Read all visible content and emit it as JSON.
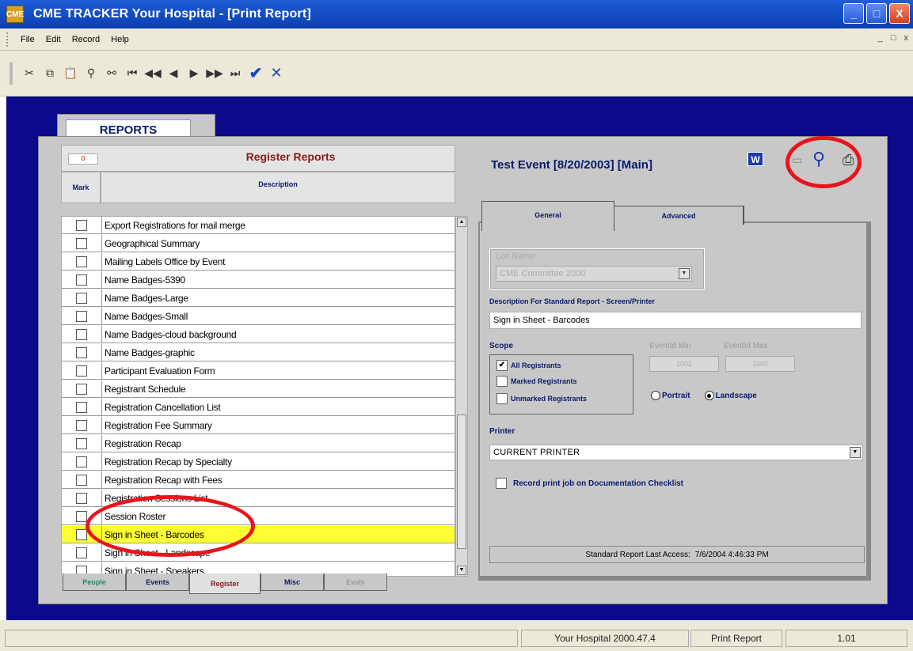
{
  "window": {
    "title": "CME TRACKER   Your Hospital - [Print Report]",
    "icon_label": "CME",
    "buttons": [
      "_",
      "□",
      "X"
    ]
  },
  "menu": {
    "items": [
      "File",
      "Edit",
      "Record",
      "Help"
    ],
    "mdi_controls": [
      "_",
      "□",
      "x"
    ]
  },
  "toolbar": {
    "icons": [
      "cut-icon",
      "copy-icon",
      "paste-icon",
      "find-icon",
      "find-replace-icon",
      "first-record-icon",
      "rewind-icon",
      "prev-record-icon",
      "next-record-icon",
      "fast-forward-icon",
      "last-record-icon",
      "save-check-icon",
      "cancel-icon"
    ]
  },
  "reports_tab": "REPORTS",
  "left": {
    "count": "0",
    "title": "Register Reports",
    "col_mark": "Mark",
    "col_desc": "Description",
    "rows": [
      {
        "label": "Export Registrations for mail merge",
        "selected": false
      },
      {
        "label": "Geographical Summary",
        "selected": false
      },
      {
        "label": "Mailing Labels Office by Event",
        "selected": false
      },
      {
        "label": "Name Badges-5390",
        "selected": false
      },
      {
        "label": "Name Badges-Large",
        "selected": false
      },
      {
        "label": "Name Badges-Small",
        "selected": false
      },
      {
        "label": "Name Badges-cloud background",
        "selected": false
      },
      {
        "label": "Name Badges-graphic",
        "selected": false
      },
      {
        "label": "Participant Evaluation Form",
        "selected": false
      },
      {
        "label": "Registrant Schedule",
        "selected": false
      },
      {
        "label": "Registration Cancellation List",
        "selected": false
      },
      {
        "label": "Registration Fee Summary",
        "selected": false
      },
      {
        "label": "Registration Recap",
        "selected": false
      },
      {
        "label": "Registration Recap by Specialty",
        "selected": false
      },
      {
        "label": "Registration Recap with Fees",
        "selected": false
      },
      {
        "label": "Registration Sessions List",
        "selected": false
      },
      {
        "label": "Session Roster",
        "selected": false
      },
      {
        "label": "Sign in Sheet - Barcodes",
        "selected": true
      },
      {
        "label": "Sign in Sheet - Landscape",
        "selected": false
      },
      {
        "label": "Sign in Sheet - Speakers",
        "selected": false
      }
    ],
    "bottom_tabs": [
      "People",
      "Events",
      "Register",
      "Misc",
      "Evals"
    ]
  },
  "right": {
    "event_title": "Test Event [8/20/2003] [Main]",
    "word_icon_label": "W",
    "tabs": [
      "General",
      "Advanced"
    ],
    "list_name_label": "List Name",
    "list_name_value": "CME Committee 2000",
    "desc_label": "Description For Standard Report - Screen/Printer",
    "desc_value": "Sign in Sheet - Barcodes",
    "scope_label": "Scope",
    "scope_options": [
      {
        "label": "All Registrants",
        "checked": true
      },
      {
        "label": "Marked Registrants",
        "checked": false
      },
      {
        "label": "Unmarked Registrants",
        "checked": false
      }
    ],
    "eventid_min_label": "EventId Min",
    "eventid_max_label": "EventId Max",
    "eventid_min_value": "1002",
    "eventid_max_value": "1002",
    "orientation": {
      "portrait": "Portrait",
      "landscape": "Landscape",
      "selected": "Landscape"
    },
    "printer_label": "Printer",
    "printer_value": "CURRENT PRINTER",
    "record_label": "Record print job on Documentation Checklist",
    "last_access_label": "Standard Report  Last Access:",
    "last_access_value": "7/6/2004 4:46:33 PM"
  },
  "status": {
    "left": "",
    "hospital": "Your Hospital 2000.47.4",
    "form": "Print Report",
    "version": "1.01"
  },
  "colors": {
    "desk": "#0c0a8a",
    "titlebar": "#1f5cd6",
    "selected_row": "#ffff33",
    "annotation": "#e8141c",
    "label_blue": "#0b1a6d",
    "title_red": "#8a1a1a"
  }
}
